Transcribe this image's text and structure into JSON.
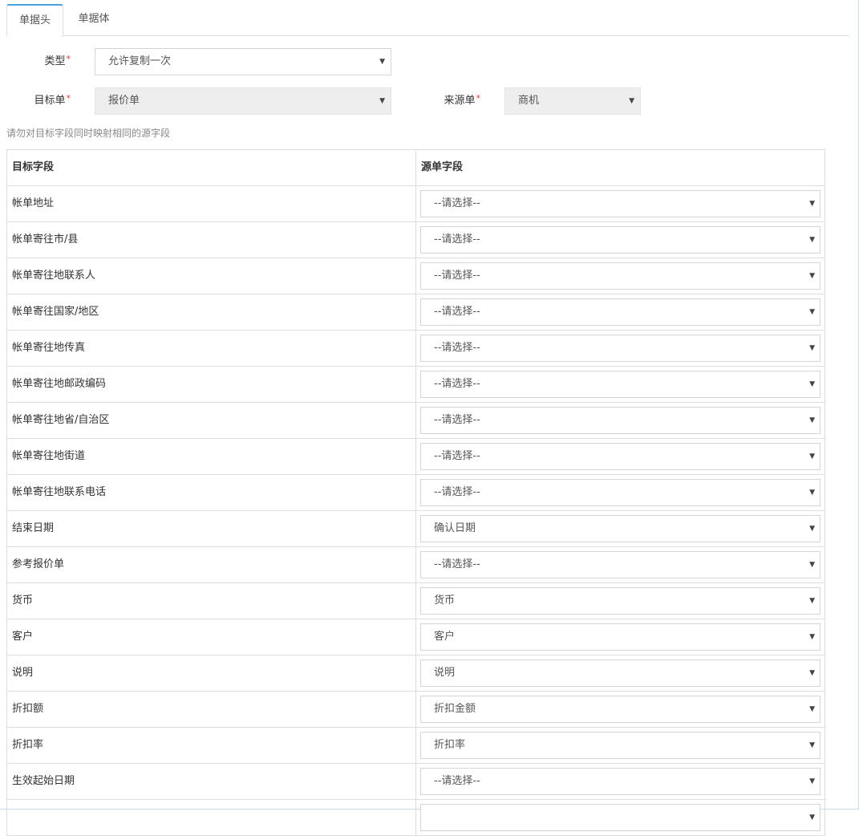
{
  "tabs": [
    {
      "label": "单据头",
      "active": true
    },
    {
      "label": "单据体",
      "active": false
    }
  ],
  "form": {
    "type_label": "类型",
    "type_value": "允许复制一次",
    "target_label": "目标单",
    "target_value": "报价单",
    "source_label": "来源单",
    "source_value": "商机",
    "required_mark": "*"
  },
  "hint": "请勿对目标字段同时映射相同的源字段",
  "table": {
    "headers": [
      "目标字段",
      "源单字段"
    ],
    "rows": [
      {
        "target": "帐单地址",
        "source": "--请选择--"
      },
      {
        "target": "帐单寄往市/县",
        "source": "--请选择--"
      },
      {
        "target": "帐单寄往地联系人",
        "source": "--请选择--"
      },
      {
        "target": "帐单寄往国家/地区",
        "source": "--请选择--"
      },
      {
        "target": "帐单寄往地传真",
        "source": "--请选择--"
      },
      {
        "target": "帐单寄往地邮政编码",
        "source": "--请选择--"
      },
      {
        "target": "帐单寄往地省/自治区",
        "source": "--请选择--"
      },
      {
        "target": "帐单寄往地街道",
        "source": "--请选择--"
      },
      {
        "target": "帐单寄往地联系电话",
        "source": "--请选择--"
      },
      {
        "target": "结束日期",
        "source": "确认日期"
      },
      {
        "target": "参考报价单",
        "source": "--请选择--"
      },
      {
        "target": "货币",
        "source": "货币"
      },
      {
        "target": "客户",
        "source": "客户"
      },
      {
        "target": "说明",
        "source": "说明"
      },
      {
        "target": "折扣额",
        "source": "折扣金额"
      },
      {
        "target": "折扣率",
        "source": "折扣率"
      },
      {
        "target": "生效起始日期",
        "source": "--请选择--"
      },
      {
        "target": "",
        "source": ""
      }
    ]
  },
  "icons": {
    "dropdown": "caret-down-icon"
  },
  "colors": {
    "tab_accent": "#4aa3df",
    "required": "#e4393c",
    "disabled_bg": "#eeeeee",
    "border": "#dddddd"
  }
}
